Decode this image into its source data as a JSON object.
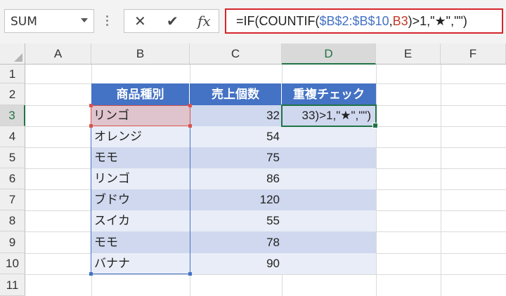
{
  "name_box": {
    "value": "SUM"
  },
  "formula_buttons": {
    "cancel": "✕",
    "enter": "✔",
    "fx": "fx"
  },
  "formula": {
    "p1": "=IF(COUNTIF(",
    "range_ref": "$B$2:$B$10",
    "comma": ",",
    "cell_ref": "B3",
    "p2": ")>1,\"★\",\"\")"
  },
  "columns": [
    "A",
    "B",
    "C",
    "D",
    "E",
    "F"
  ],
  "rows": [
    "1",
    "2",
    "3",
    "4",
    "5",
    "6",
    "7",
    "8",
    "9",
    "10",
    "11"
  ],
  "table": {
    "headers": [
      "商品種別",
      "売上個数",
      "重複チェック"
    ],
    "rows": [
      {
        "item": "リンゴ",
        "qty": "32"
      },
      {
        "item": "オレンジ",
        "qty": "54"
      },
      {
        "item": "モモ",
        "qty": "75"
      },
      {
        "item": "リンゴ",
        "qty": "86"
      },
      {
        "item": "ブドウ",
        "qty": "120"
      },
      {
        "item": "スイカ",
        "qty": "55"
      },
      {
        "item": "モモ",
        "qty": "78"
      },
      {
        "item": "バナナ",
        "qty": "90"
      }
    ]
  },
  "active_cell_text": "33)>1,\"★\",\"\")",
  "colors": {
    "header": "#4472c4",
    "band_dark": "#cfd8ee",
    "band_light": "#e9edf7",
    "formula_border": "#d6262b",
    "selection": "#217346"
  }
}
